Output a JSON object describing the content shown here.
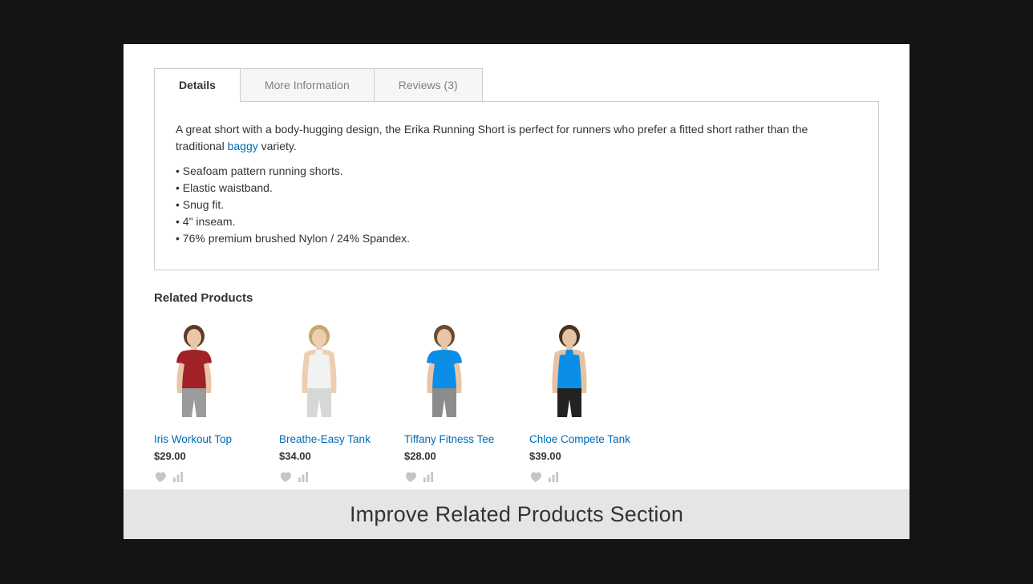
{
  "tabs": {
    "details": "Details",
    "more_info": "More Information",
    "reviews": "Reviews (3)"
  },
  "details": {
    "lead_before": "A great short with a body-hugging design, the Erika Running Short is perfect for runners who prefer a fitted short rather than the traditional ",
    "link_text": "baggy",
    "lead_after": " variety.",
    "bullets": [
      "• Seafoam pattern running shorts.",
      "• Elastic waistband.",
      "• Snug fit.",
      "• 4\" inseam.",
      "• 76% premium brushed Nylon / 24% Spandex."
    ]
  },
  "related": {
    "heading": "Related Products",
    "products": [
      {
        "name": "Iris Workout Top",
        "price": "$29.00",
        "shirt": "#a02227",
        "sleeves": "short",
        "bottoms": "#9b9b9b",
        "skin": "#e9c6a7",
        "hair": "#5a3a28"
      },
      {
        "name": "Breathe-Easy Tank",
        "price": "$34.00",
        "shirt": "#f2f2f2",
        "sleeves": "tank",
        "bottoms": "#d7d7d7",
        "skin": "#edcfb0",
        "hair": "#c9a66b"
      },
      {
        "name": "Tiffany Fitness Tee",
        "price": "$28.00",
        "shirt": "#0b8ee6",
        "sleeves": "short",
        "bottoms": "#8c8c8c",
        "skin": "#e8c5a6",
        "hair": "#6b4a32"
      },
      {
        "name": "Chloe Compete Tank",
        "price": "$39.00",
        "shirt": "#0b8ee6",
        "sleeves": "tank",
        "bottoms": "#222222",
        "skin": "#e6c2a3",
        "hair": "#4a3220"
      }
    ]
  },
  "caption": "Improve Related Products Section"
}
